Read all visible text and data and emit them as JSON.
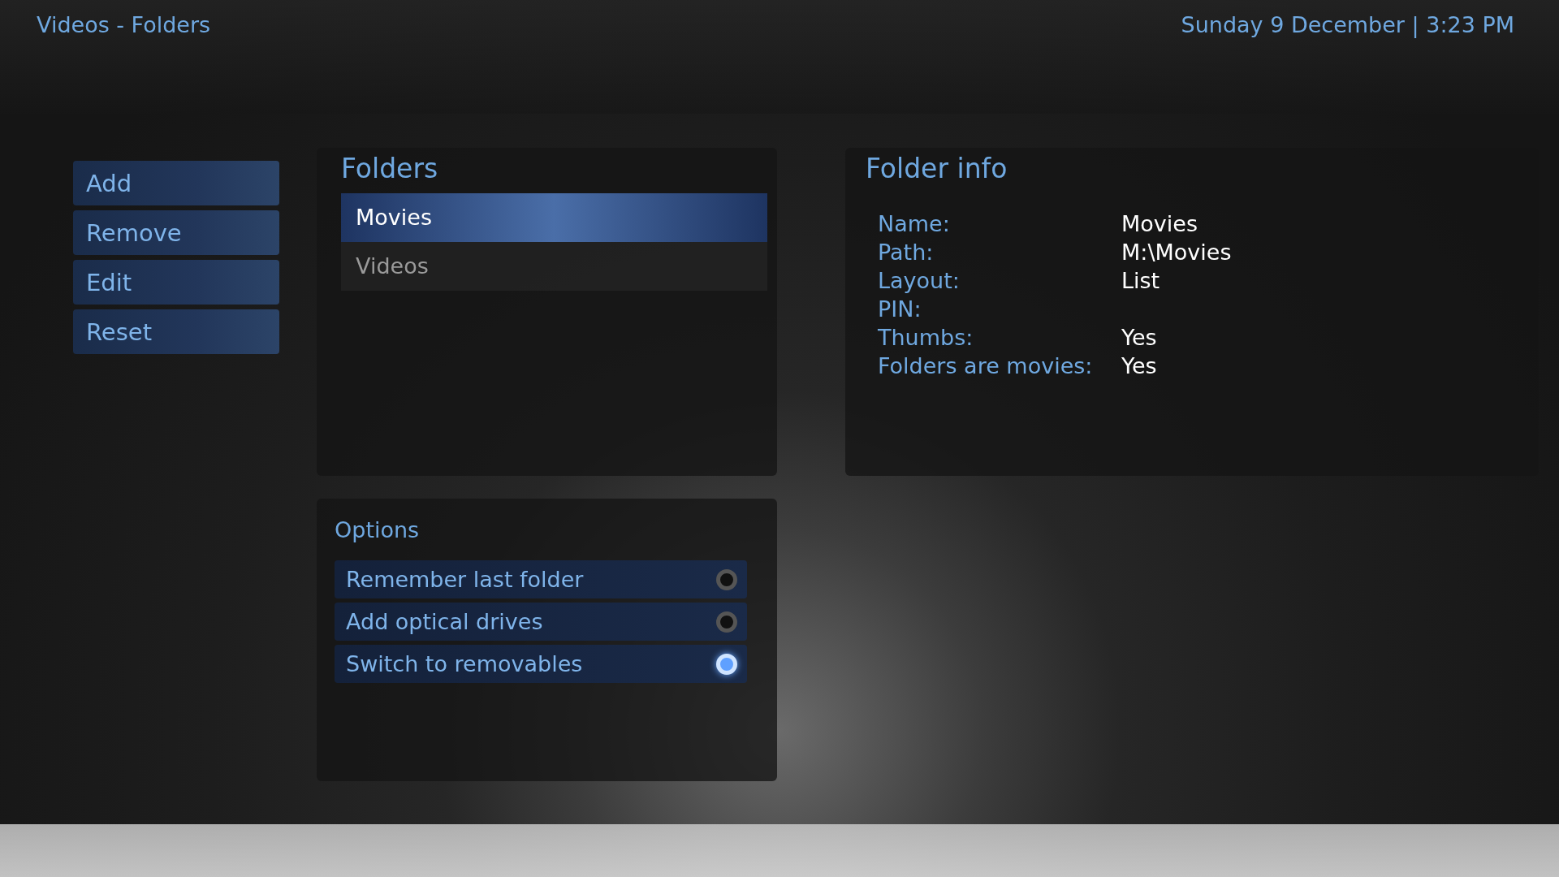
{
  "header": {
    "title": "Videos - Folders",
    "datetime": "Sunday 9 December | 3:23 PM"
  },
  "actions": [
    {
      "label": "Add"
    },
    {
      "label": "Remove"
    },
    {
      "label": "Edit"
    },
    {
      "label": "Reset"
    }
  ],
  "folders": {
    "title": "Folders",
    "items": [
      {
        "label": "Movies",
        "selected": true
      },
      {
        "label": "Videos",
        "selected": false
      }
    ]
  },
  "folder_info": {
    "title": "Folder info",
    "rows": [
      {
        "label": "Name:",
        "value": "Movies"
      },
      {
        "label": "Path:",
        "value": "M:\\Movies"
      },
      {
        "label": "Layout:",
        "value": "List"
      },
      {
        "label": "PIN:"
      },
      {
        "label": "Thumbs:",
        "value": "Yes"
      },
      {
        "label": "Folders are movies:",
        "value": "Yes"
      }
    ]
  },
  "options": {
    "title": "Options",
    "items": [
      {
        "label": "Remember last folder",
        "on": false
      },
      {
        "label": "Add optical drives",
        "on": false
      },
      {
        "label": "Switch to removables",
        "on": true
      }
    ]
  }
}
